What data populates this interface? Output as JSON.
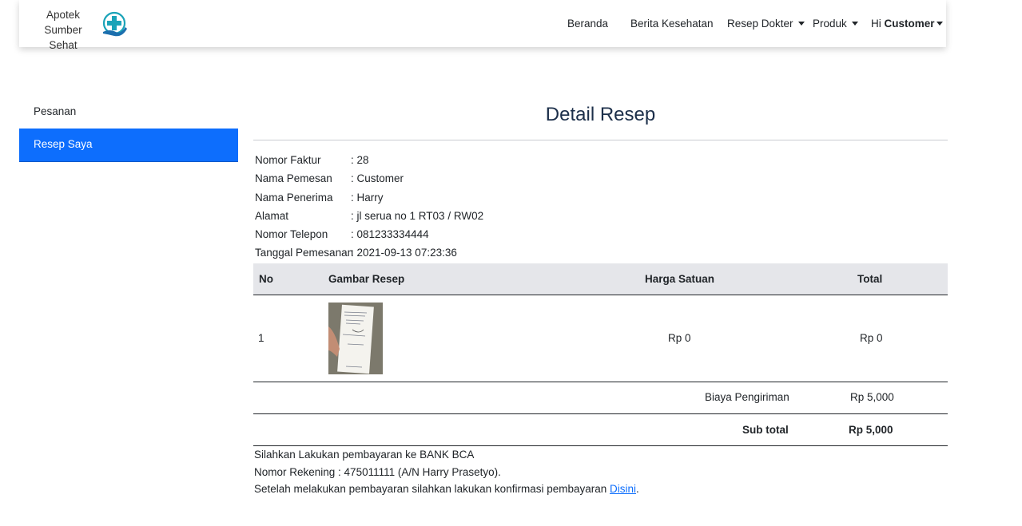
{
  "brand": {
    "line1": "Apotek",
    "line2": "Sumber Sehat",
    "logo_icon": "medical-cross-hand-icon"
  },
  "nav": {
    "beranda": "Beranda",
    "berita": "Berita Kesehatan",
    "resep": "Resep Dokter",
    "produk": "Produk",
    "greeting": "Hi",
    "user": "Customer"
  },
  "sidebar": {
    "items": [
      {
        "label": "Pesanan"
      },
      {
        "label": "Resep Saya"
      }
    ]
  },
  "page": {
    "title": "Detail Resep"
  },
  "info": {
    "rows": [
      {
        "label": "Nomor Faktur",
        "value": ": 28"
      },
      {
        "label": "Nama Pemesan",
        "value": ": Customer"
      },
      {
        "label": "Nama Penerima",
        "value": ": Harry"
      },
      {
        "label": "Alamat",
        "value": ": jl serua no 1 RT03 / RW02"
      },
      {
        "label": "Nomor Telepon",
        "value": ": 081233334444"
      },
      {
        "label": "Tanggal Pemesanan",
        "value": ": 2021-09-13 07:23:36"
      }
    ]
  },
  "table": {
    "headers": {
      "no": "No",
      "gambar": "Gambar Resep",
      "harga": "Harga Satuan",
      "total": "Total"
    },
    "rows": [
      {
        "no": "1",
        "harga": "Rp 0",
        "total": "Rp 0"
      }
    ],
    "shipping_label": "Biaya Pengiriman",
    "shipping_value": "Rp 5,000",
    "subtotal_label": "Sub total",
    "subtotal_value": "Rp 5,000"
  },
  "payment": {
    "line1": "Silahkan Lakukan pembayaran ke BANK BCA",
    "line2": "Nomor Rekening : 475011111 (A/N Harry Prasetyo).",
    "line3_prefix": "Setelah melakukan pembayaran silahkan lakukan konfirmasi pembayaran",
    "link": "Disini",
    "line3_suffix": "."
  },
  "colors": {
    "primary": "#0d6efd",
    "title": "#1c2f4a",
    "logo": "#1aa3b8"
  }
}
